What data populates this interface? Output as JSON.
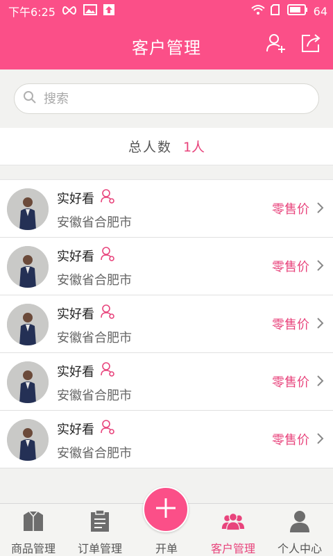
{
  "status_bar": {
    "time": "下午6:25",
    "battery_level": "64",
    "icons": [
      "infinity-icon",
      "image-icon",
      "upload-icon",
      "wifi-icon",
      "sim-icon",
      "battery-icon"
    ]
  },
  "header": {
    "title": "客户管理",
    "actions": [
      "add-customer-icon",
      "share-icon"
    ]
  },
  "search": {
    "placeholder": "搜索"
  },
  "summary": {
    "label": "总人数",
    "count": "1人"
  },
  "customers": [
    {
      "name": "实好看",
      "city": "安徽省合肥市",
      "price_type": "零售价"
    },
    {
      "name": "实好看",
      "city": "安徽省合肥市",
      "price_type": "零售价"
    },
    {
      "name": "实好看",
      "city": "安徽省合肥市",
      "price_type": "零售价"
    },
    {
      "name": "实好看",
      "city": "安徽省合肥市",
      "price_type": "零售价"
    },
    {
      "name": "实好看",
      "city": "安徽省合肥市",
      "price_type": "零售价"
    }
  ],
  "bottom_nav": {
    "tabs": [
      {
        "label": "商品管理",
        "icon": "shirt-icon",
        "active": false
      },
      {
        "label": "订单管理",
        "icon": "clipboard-icon",
        "active": false
      },
      {
        "label": "开单",
        "icon": "plus-icon",
        "active": false
      },
      {
        "label": "客户管理",
        "icon": "customers-icon",
        "active": true
      },
      {
        "label": "个人中心",
        "icon": "person-icon",
        "active": false
      }
    ]
  },
  "colors": {
    "brand_pink": "#fb4f88",
    "accent_text": "#e8447c",
    "background": "#f2f2f0"
  }
}
